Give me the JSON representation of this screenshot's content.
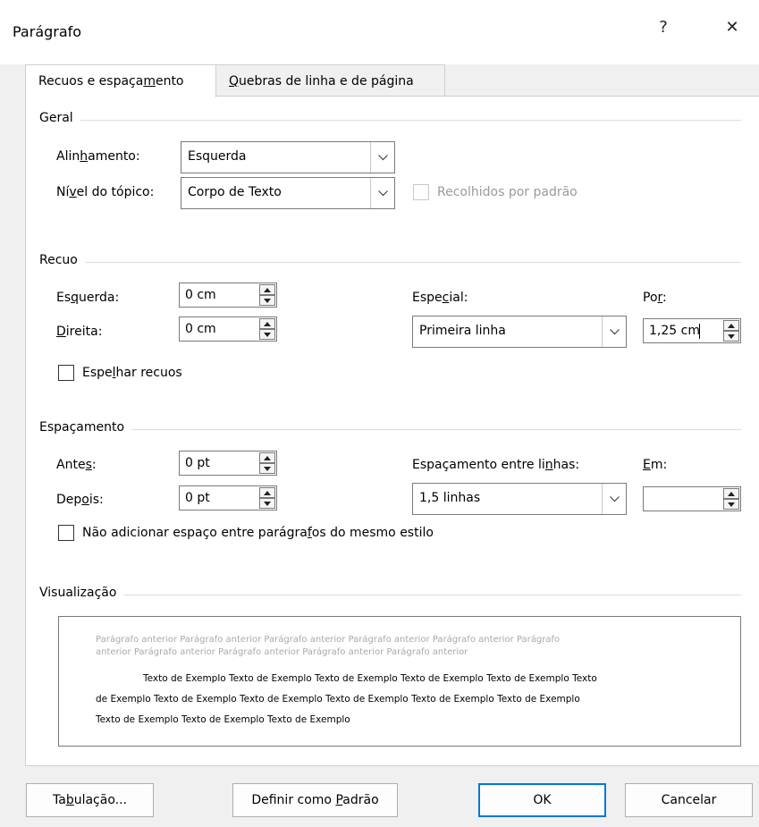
{
  "dialog": {
    "title": "Parágrafo",
    "help": "?",
    "close": "✕"
  },
  "tabs": [
    {
      "label_a": "Recuos e espaça",
      "label_u": "m",
      "label_b": "ento"
    },
    {
      "label_a": "",
      "label_u": "Q",
      "label_b": "uebras de linha e de página"
    }
  ],
  "geral": {
    "heading": "Geral",
    "alignment_label_a": "Alin",
    "alignment_label_u": "h",
    "alignment_label_b": "amento:",
    "alignment_value": "Esquerda",
    "outline_label_a": "Ní",
    "outline_label_u": "v",
    "outline_label_b": "el do tópico:",
    "outline_value": "Corpo de Texto",
    "collapsed_label": "Recolhidos por padrão"
  },
  "recuo": {
    "heading": "Recuo",
    "left_label_a": "Es",
    "left_label_u": "q",
    "left_label_b": "uerda:",
    "left_value": "0 cm",
    "right_label_a": "",
    "right_label_u": "D",
    "right_label_b": "ireita:",
    "right_value": "0 cm",
    "special_label_a": "Espe",
    "special_label_u": "c",
    "special_label_b": "ial:",
    "special_value": "Primeira linha",
    "by_label_a": "Po",
    "by_label_u": "r",
    "by_label_b": ":",
    "by_value": "1,25 cm",
    "mirror_label_a": "Espe",
    "mirror_label_u": "l",
    "mirror_label_b": "har recuos"
  },
  "espacamento": {
    "heading": "Espaçamento",
    "before_label_a": "Ante",
    "before_label_u": "s",
    "before_label_b": ":",
    "before_value": "0 pt",
    "after_label_a": "Dep",
    "after_label_u": "o",
    "after_label_b": "is:",
    "after_value": "0 pt",
    "line_label_a": "Espaçamento entre li",
    "line_label_u": "n",
    "line_label_b": "has:",
    "line_value": "1,5 linhas",
    "at_label_a": "",
    "at_label_u": "E",
    "at_label_b": "m:",
    "at_value": "",
    "no_space_label_a": "Não adicionar espaço entre parágra",
    "no_space_label_u": "f",
    "no_space_label_b": "os do mesmo estilo"
  },
  "preview": {
    "heading": "Visualização",
    "previous_line1": "Parágrafo anterior Parágrafo anterior Parágrafo anterior Parágrafo anterior Parágrafo anterior Parágrafo",
    "previous_line2": "anterior Parágrafo anterior Parágrafo anterior Parágrafo anterior Parágrafo anterior",
    "sample_line1": "Texto de Exemplo Texto de Exemplo Texto de Exemplo Texto de Exemplo Texto de Exemplo Texto",
    "sample_line2": "de Exemplo Texto de Exemplo Texto de Exemplo Texto de Exemplo Texto de Exemplo Texto de Exemplo",
    "sample_line3": "Texto de Exemplo Texto de Exemplo Texto de Exemplo"
  },
  "buttons": {
    "tabs_a": "Ta",
    "tabs_u": "b",
    "tabs_b": "ulação...",
    "default_a": "Definir como ",
    "default_u": "P",
    "default_b": "adrão",
    "ok": "OK",
    "cancel": "Cancelar"
  },
  "colors": {
    "accent": "#0078d7",
    "disabled_text": "#9a9a9a",
    "preview_previous_text": "#a9a9a9"
  }
}
